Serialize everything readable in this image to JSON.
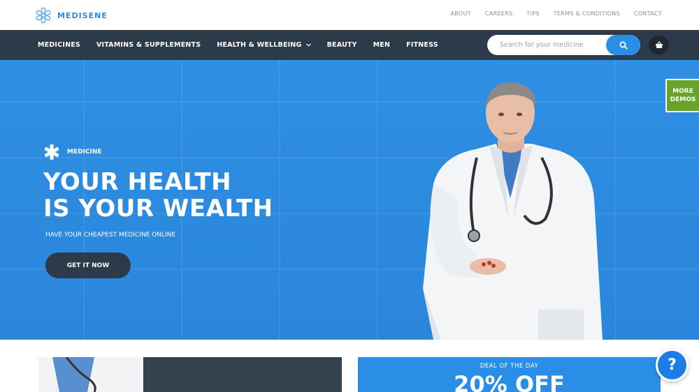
{
  "brand": {
    "name": "MEDISENE",
    "accent": "#2a8ee6"
  },
  "top_links": [
    "ABOUT",
    "CAREERS",
    "TIPS",
    "TERMS & CONDITIONS",
    "CONTACT"
  ],
  "nav": {
    "items": [
      {
        "label": "MEDICINES"
      },
      {
        "label": "VITAMINS & SUPPLEMENTS"
      },
      {
        "label": "HEALTH & WELLBEING",
        "has_dropdown": true
      },
      {
        "label": "BEAUTY"
      },
      {
        "label": "MEN"
      },
      {
        "label": "FITNESS"
      }
    ],
    "search_placeholder": "Search for your medicine",
    "search_icon": "search-icon",
    "cart_icon": "basket-icon"
  },
  "hero": {
    "tag": "MEDICINE",
    "title_line1": "YOUR HEALTH",
    "title_line2": "IS YOUR WEALTH",
    "subtitle": "HAVE YOUR CHEAPEST MEDICINE ONLINE",
    "cta": "GET IT NOW",
    "background": "#2e8fe3"
  },
  "more_demos": {
    "line1": "MORE",
    "line2": "DEMOS",
    "color": "#6aa329"
  },
  "deal": {
    "label": "DEAL OF THE DAY",
    "value": "20% OFF"
  },
  "help_button": "?"
}
